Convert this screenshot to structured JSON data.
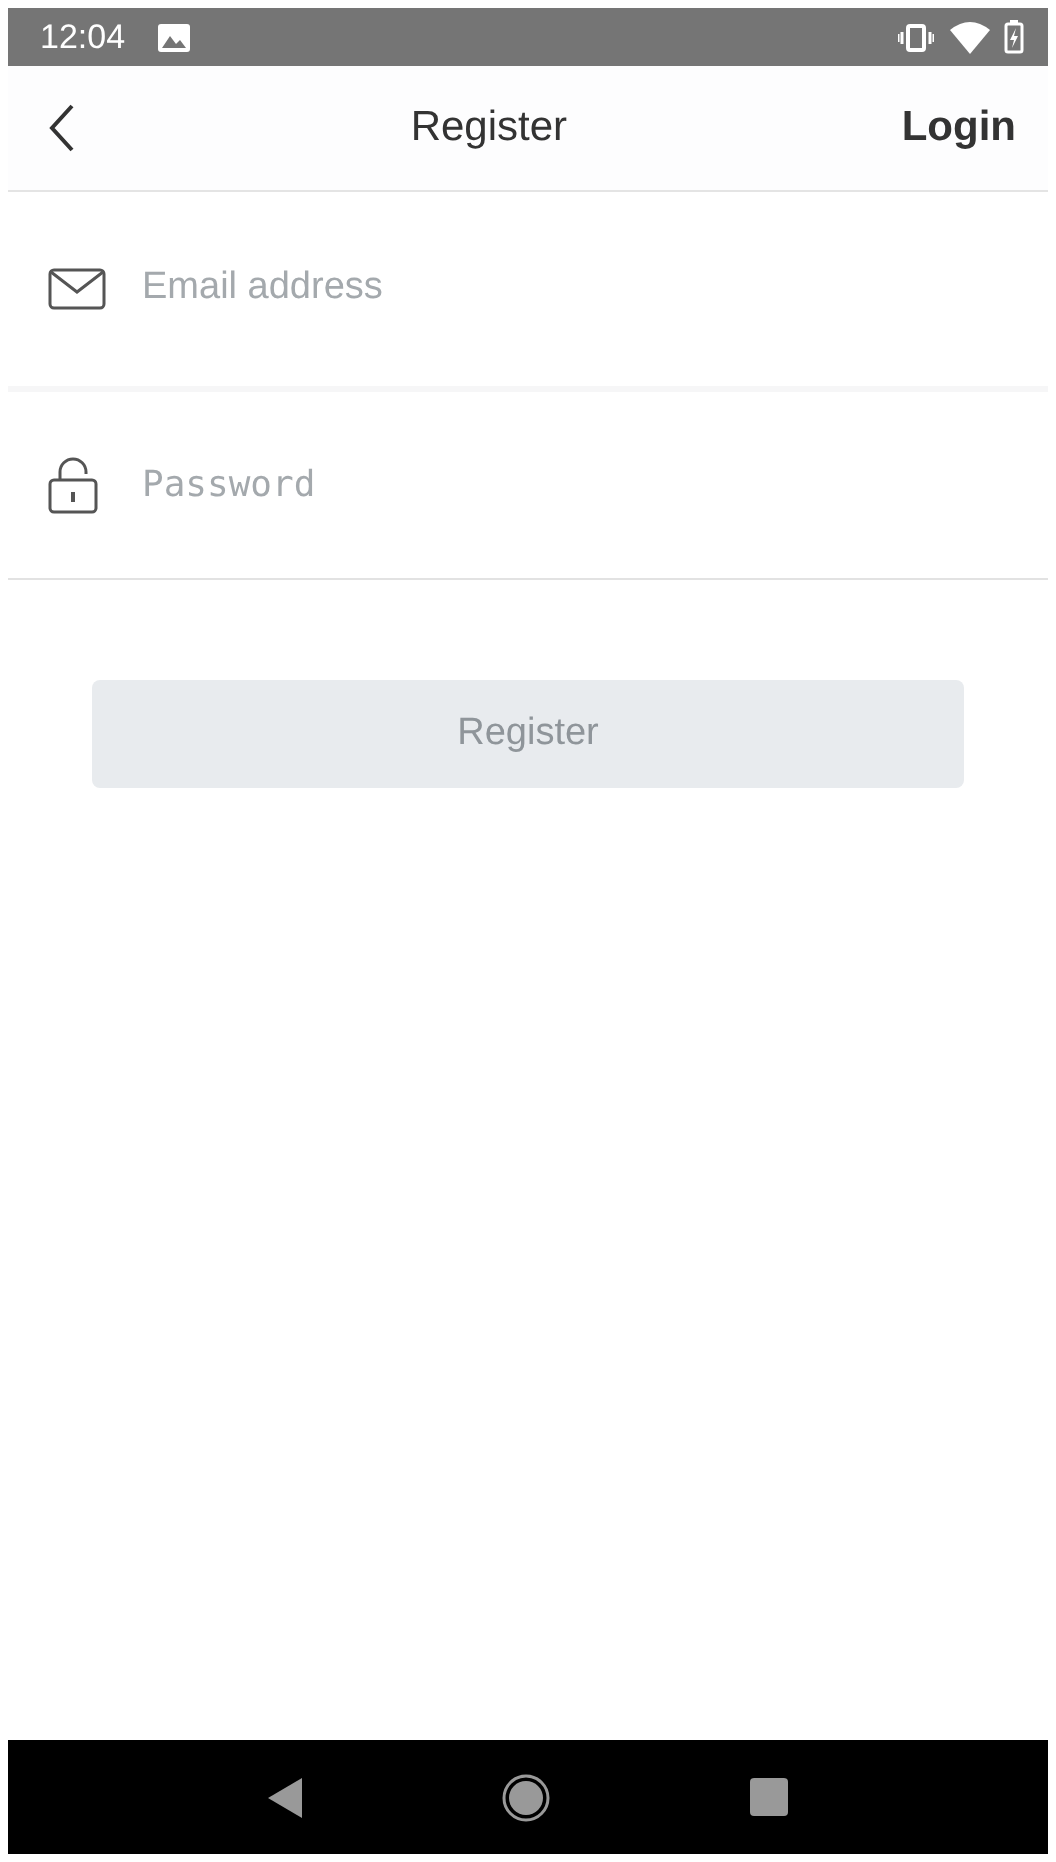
{
  "status_bar": {
    "time": "12:04"
  },
  "header": {
    "title": "Register",
    "action": "Login"
  },
  "fields": [
    {
      "kind": "email",
      "placeholder": "Email address"
    },
    {
      "kind": "password",
      "placeholder": "Password"
    }
  ],
  "submit": {
    "label": "Register",
    "disabled": true
  }
}
